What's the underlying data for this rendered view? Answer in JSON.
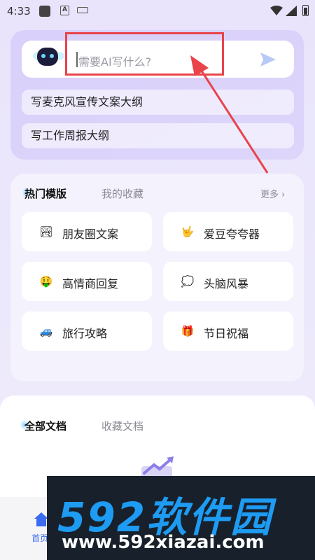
{
  "status_bar": {
    "time": "4:33",
    "a_icon": "A"
  },
  "composer": {
    "placeholder": "需要AI写什么?",
    "icons": {
      "bot": "robot-face-icon",
      "send": "send-arrow-icon"
    },
    "highlight_color": "#e8444a"
  },
  "suggestions": [
    {
      "label": "写麦克风宣传文案大纲"
    },
    {
      "label": "写工作周报大纲"
    }
  ],
  "templates": {
    "tab_hot": "热门模版",
    "tab_favorites": "我的收藏",
    "more": "更多 ›",
    "items": [
      {
        "label": "朋友圈文案",
        "icon": "photo-icon",
        "glyph": "🏞"
      },
      {
        "label": "爱豆夸夸器",
        "icon": "rock-hand-icon",
        "glyph": "🤟"
      },
      {
        "label": "高情商回复",
        "icon": "money-face-icon",
        "glyph": "🤑"
      },
      {
        "label": "头脑风暴",
        "icon": "thought-bubble-icon",
        "glyph": "💭"
      },
      {
        "label": "旅行攻略",
        "icon": "car-icon",
        "glyph": "🚙"
      },
      {
        "label": "节日祝福",
        "icon": "gift-icon",
        "glyph": "🎁"
      }
    ]
  },
  "documents": {
    "tab_all": "全部文档",
    "tab_favorites": "收藏文档"
  },
  "bottom_nav": {
    "home_label": "首页"
  },
  "watermark": {
    "brand": "592软件园",
    "url": "www.592xiazai.com"
  },
  "colors": {
    "accent": "#3b6cf0",
    "brand_blue": "#1e9bf2"
  }
}
